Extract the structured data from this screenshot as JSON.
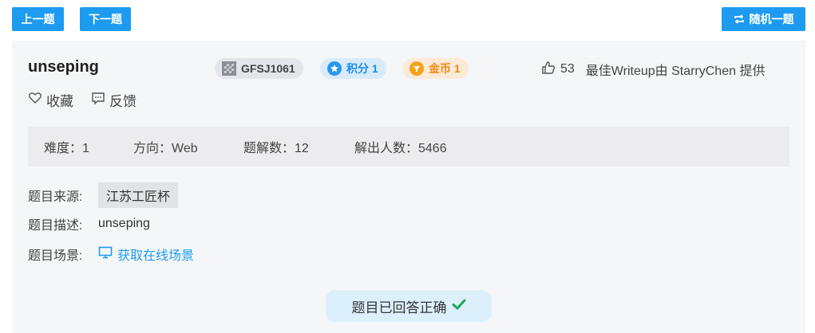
{
  "nav": {
    "prev_label": "上一题",
    "next_label": "下一题",
    "random_label": "随机一题"
  },
  "challenge": {
    "title": "unseping",
    "id_badge": "GFSJ1061",
    "score_badge": "积分 1",
    "coin_badge": "金币 1",
    "likes": "53",
    "best_writeup": "最佳Writeup由 StarryChen 提供"
  },
  "actions": {
    "favorite_label": "收藏",
    "feedback_label": "反馈"
  },
  "stats": {
    "difficulty": "难度：1",
    "direction": "方向：Web",
    "solutions": "题解数：12",
    "solvers": "解出人数：5466"
  },
  "info": {
    "source_label": "题目来源:",
    "source_value": "江苏工匠杯",
    "desc_label": "题目描述:",
    "desc_value": "unseping",
    "scene_label": "题目场景:",
    "scene_link": "获取在线场景"
  },
  "status": {
    "solved_text": "题目已回答正确"
  },
  "colors": {
    "accent": "#1d9bf0",
    "score": "#1c8ee9",
    "coin": "#ee8a12",
    "success": "#1aaa55"
  },
  "icons": {
    "random": "repeat-icon",
    "id_badge": "qr-code-icon",
    "score": "star-badge-icon",
    "coin": "coin-icon",
    "like": "thumbs-up-icon",
    "favorite": "heart-icon",
    "feedback": "message-icon",
    "scene": "monitor-icon",
    "solved": "check-icon"
  }
}
